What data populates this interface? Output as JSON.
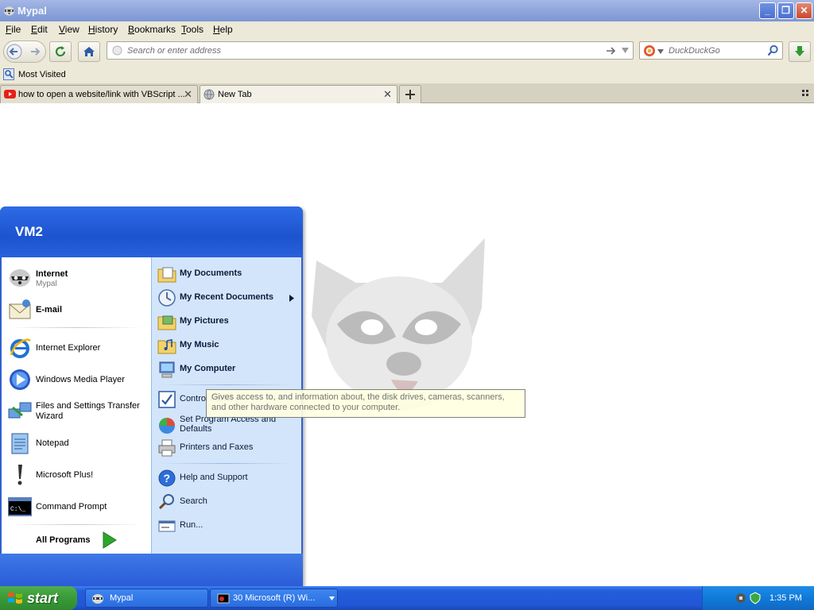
{
  "window": {
    "title": "Mypal",
    "min_label": "_",
    "max_label": "❐",
    "close_label": "✕"
  },
  "menubar": {
    "items": [
      {
        "label": "File",
        "key": "F",
        "rest": "ile"
      },
      {
        "label": "Edit",
        "key": "E",
        "rest": "dit"
      },
      {
        "label": "View",
        "key": "V",
        "rest": "iew"
      },
      {
        "label": "History",
        "key": "H",
        "rest": "istory"
      },
      {
        "label": "Bookmarks",
        "key": "B",
        "rest": "ookmarks"
      },
      {
        "label": "Tools",
        "key": "T",
        "rest": "ools"
      },
      {
        "label": "Help",
        "key": "H",
        "rest": "elp"
      }
    ]
  },
  "navbar": {
    "url_placeholder": "Search or enter address",
    "search_placeholder": "DuckDuckGo"
  },
  "bookmarks": {
    "most_visited": "Most Visited"
  },
  "tabs": [
    {
      "label": "how to open a website/link with VBScript ...",
      "active": false
    },
    {
      "label": "New Tab",
      "active": true
    }
  ],
  "start_menu": {
    "user": "VM2",
    "pinned": [
      {
        "title": "Internet",
        "subtitle": "Mypal",
        "icon": "mypal-raccoon-icon"
      },
      {
        "title": "E-mail",
        "subtitle": "",
        "icon": "email-envelope-icon"
      }
    ],
    "recent": [
      {
        "title": "Internet Explorer",
        "icon": "internet-explorer-icon"
      },
      {
        "title": "Windows Media Player",
        "icon": "media-player-icon"
      },
      {
        "title": "Files and Settings Transfer",
        "title2": "Wizard",
        "icon": "transfer-wizard-icon"
      },
      {
        "title": "Notepad",
        "icon": "notepad-icon"
      },
      {
        "title": "Microsoft Plus!",
        "icon": "exclamation-icon"
      },
      {
        "title": "Command Prompt",
        "icon": "command-prompt-icon"
      }
    ],
    "all_programs": "All Programs",
    "places": [
      {
        "title": "My Documents",
        "icon": "folder-documents-icon"
      },
      {
        "title": "My Recent Documents",
        "icon": "recent-documents-icon"
      },
      {
        "title": "My Pictures",
        "icon": "folder-pictures-icon"
      },
      {
        "title": "My Music",
        "icon": "folder-music-icon"
      },
      {
        "title": "My Computer",
        "icon": "computer-icon"
      }
    ],
    "system": [
      {
        "title": "Control Panel",
        "icon": "control-panel-icon"
      },
      {
        "title": "Set Program Access and",
        "title2": "Defaults",
        "icon": "program-access-icon"
      },
      {
        "title": "Printers and Faxes",
        "icon": "printer-icon"
      }
    ],
    "help": [
      {
        "title": "Help and Support",
        "icon": "help-icon"
      },
      {
        "title": "Search",
        "icon": "search-icon"
      },
      {
        "title": "Run...",
        "icon": "run-icon"
      }
    ],
    "tooltip": "Gives access to, and information about, the disk drives, cameras, scanners, and other hardware connected to your computer."
  },
  "taskbar": {
    "start_label": "start",
    "tasks": [
      {
        "label": "Mypal",
        "icon": "mypal-raccoon-icon"
      },
      {
        "label": "30 Microsoft (R) Wi...",
        "icon": "command-window-icon"
      }
    ],
    "clock": "1:35 PM"
  },
  "colors": {
    "taskbar": "#245edb",
    "start_button": "#3a9a38",
    "start_menu_header": "#1d53cf",
    "places_bg": "#d3e5fa"
  }
}
